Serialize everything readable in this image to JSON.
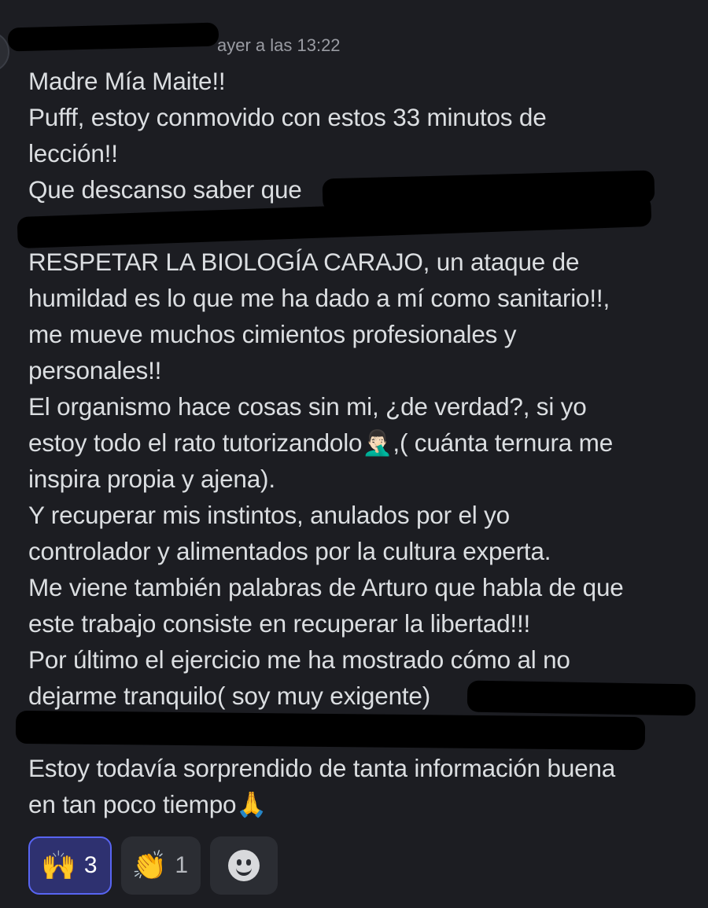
{
  "message": {
    "timestamp": "ayer a las 13:22",
    "lines": [
      "Madre Mía Maite!!",
      "Pufff, estoy conmovido con estos 33 minutos de",
      "lección!!",
      "Que descanso saber que",
      "",
      "RESPETAR LA BIOLOGÍA CARAJO, un ataque de",
      "humildad es lo que me ha dado a mí como sanitario!!,",
      "me mueve muchos cimientos profesionales y",
      "personales!!",
      "El organismo hace cosas sin mi, ¿de verdad?, si yo",
      "estoy todo el rato tutorizandolo🤦🏻‍♂️,( cuánta ternura me",
      "inspira propia y ajena).",
      "Y recuperar mis instintos, anulados por el yo",
      "controlador y alimentados por la cultura experta.",
      "Me viene también palabras de Arturo que habla de que",
      "este trabajo consiste en recuperar la libertad!!!",
      "Por último el ejercicio me ha mostrado cómo al no",
      "dejarme tranquilo( soy muy exigente)",
      "",
      "Estoy todavía sorprendido de tanta información buena",
      "en tan poco tiempo🙏"
    ]
  },
  "reactions": [
    {
      "emoji": "🙌",
      "count": "3",
      "active": true
    },
    {
      "emoji": "👏",
      "count": "1",
      "active": false
    }
  ],
  "icons": {
    "add_reaction": "smiley-add-reaction-icon"
  }
}
